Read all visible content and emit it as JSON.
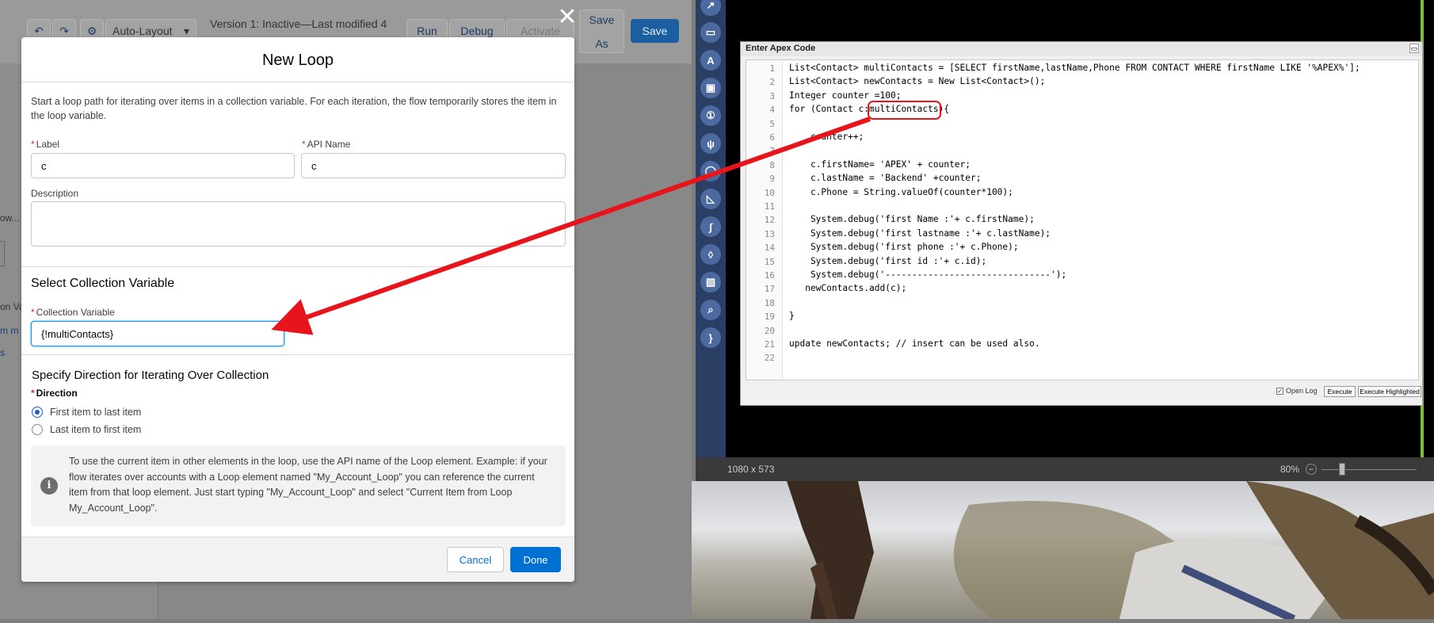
{
  "toolbar": {
    "layout": "Auto-Layout",
    "version": "Version 1: Inactive—Last modified 4",
    "run": "Run",
    "debug": "Debug",
    "activate": "Activate",
    "save_as_1": "Save",
    "save_as_2": "As",
    "save": "Save"
  },
  "sidebar_fragments": [
    "ow...",
    "on Va",
    "m m",
    "s"
  ],
  "modal": {
    "title": "New Loop",
    "description": "Start a loop path for iterating over items in a collection variable. For each iteration, the flow temporarily stores the item in the loop variable.",
    "label_label": "Label",
    "label_value": "c",
    "api_label": "API Name",
    "api_value": "c",
    "desc_label": "Description",
    "collection_section": "Select Collection Variable",
    "collection_label": "Collection Variable",
    "collection_value": "{!multiContacts}",
    "direction_section": "Specify Direction for Iterating Over Collection",
    "direction_label": "Direction",
    "option_first": "First item to last item",
    "option_last": "Last item to first item",
    "info_text": "To use the current item in other elements in the loop, use the API name of the Loop element. Example: if your flow iterates over accounts with a Loop element named \"My_Account_Loop\" you can reference the current item from that loop element. Just start typing \"My_Account_Loop\" and select \"Current Item from Loop My_Account_Loop\".",
    "cancel": "Cancel",
    "done": "Done"
  },
  "apex": {
    "title": "Enter Apex Code",
    "lines": [
      "List<Contact> multiContacts = [SELECT firstName,lastName,Phone FROM CONTACT WHERE firstName LIKE '%APEX%'];",
      "List<Contact> newContacts = New List<Contact>();",
      "Integer counter =100;",
      "for (Contact c:multiContacts){",
      "",
      "    counter++;",
      "",
      "    c.firstName= 'APEX' + counter;",
      "    c.lastName = 'Backend' +counter;",
      "    c.Phone = String.valueOf(counter*100);",
      "",
      "    System.debug('first Name :'+ c.firstName);",
      "    System.debug('first lastname :'+ c.lastName);",
      "    System.debug('first phone :'+ c.Phone);",
      "    System.debug('first id :'+ c.id);",
      "    System.debug('-------------------------------');",
      "   newContacts.add(c);",
      "",
      "}",
      "",
      "update newContacts; // insert can be used also.",
      ""
    ],
    "open_log": "Open Log",
    "execute": "Execute",
    "execute_highlighted": "Execute Highlighted"
  },
  "status": {
    "dimensions": "1080 x 573",
    "zoom": "80%"
  },
  "colors": {
    "brand_blue": "#0070d2",
    "arrow_red": "#e8141b"
  }
}
